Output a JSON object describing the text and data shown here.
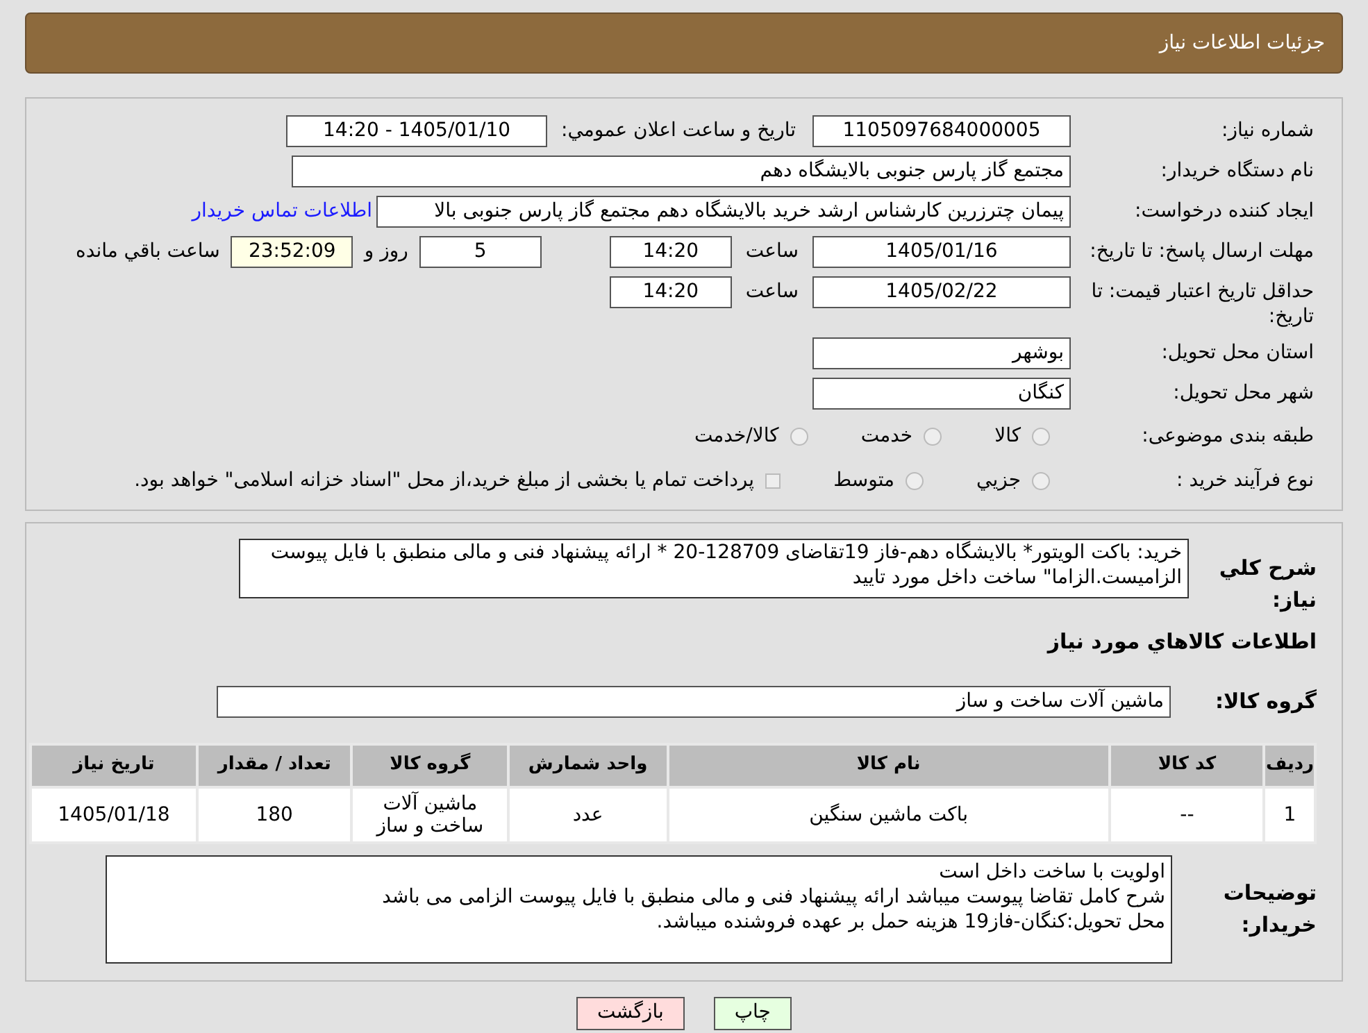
{
  "header": {
    "title": "جزئیات اطلاعات نیاز"
  },
  "details": {
    "need_number": {
      "label": "شماره نیاز:",
      "value": "1105097684000005"
    },
    "announce": {
      "label": "تاریخ و ساعت اعلان عمومي:",
      "value": "1405/01/10 - 14:20"
    },
    "buyer_org": {
      "label": "نام دستگاه خریدار:",
      "value": "مجتمع گاز پارس جنوبی  بالایشگاه دهم"
    },
    "creator": {
      "label": "ایجاد کننده درخواست:",
      "value": "پیمان چترزرین کارشناس ارشد خرید بالایشگاه دهم مجتمع گاز پارس جنوبی  بالا",
      "link": "اطلاعات تماس خریدار"
    },
    "deadline": {
      "label": "مهلت ارسال پاسخ: تا تاریخ:",
      "date": "1405/01/16",
      "time_label": "ساعت",
      "time": "14:20",
      "days": "5",
      "days_label": "روز و",
      "remaining": "23:52:09",
      "remaining_label": "ساعت باقي مانده"
    },
    "validity": {
      "label": "حداقل تاریخ اعتبار قیمت: تا تاریخ:",
      "date": "1405/02/22",
      "time_label": "ساعت",
      "time": "14:20"
    },
    "province": {
      "label": "استان محل تحویل:",
      "value": "بوشهر"
    },
    "city": {
      "label": "شهر محل تحویل:",
      "value": "کنگان"
    },
    "category": {
      "label": "طبقه بندی موضوعی:",
      "options": [
        {
          "label": "کالا",
          "selected": false
        },
        {
          "label": "خدمت",
          "selected": false
        },
        {
          "label": "کالا/خدمت",
          "selected": false
        }
      ]
    },
    "process": {
      "label": "نوع فرآیند خرید :",
      "options": [
        {
          "label": "جزيي",
          "selected": false
        },
        {
          "label": "متوسط",
          "selected": false
        }
      ],
      "payment": {
        "label": "پرداخت تمام یا بخشی از مبلغ خرید،از محل \"اسناد خزانه اسلامی\" خواهد بود.",
        "checked": false
      }
    }
  },
  "summary": {
    "label": "شرح کلي نیاز:",
    "value": "خرید: باکت الویتور* بالایشگاه دهم-فاز 19تقاضای 128709-20 * ارائه پیشنهاد فنی و مالی منطبق با فایل پیوست الزامیست.الزاما\" ساخت داخل مورد تایید"
  },
  "goods_title": "اطلاعات کالاهاي مورد نیاز",
  "goods_group": {
    "label": "گروه کالا:",
    "value": "ماشین آلات ساخت و ساز"
  },
  "table": {
    "columns": [
      "ردیف",
      "کد کالا",
      "نام کالا",
      "واحد شمارش",
      "گروه کالا",
      "تعداد / مقدار",
      "تاریخ نیاز"
    ],
    "rows": [
      [
        "1",
        "--",
        "باکت ماشین سنگین",
        "عدد",
        "ماشین آلات ساخت و ساز",
        "180",
        "1405/01/18"
      ]
    ]
  },
  "notes": {
    "label": "توضیحات خریدار:",
    "lines": [
      "اولویت با ساخت داخل است",
      "شرح کامل تقاضا پیوست میباشد ارائه پیشنهاد فنی و مالی منطبق با فایل پیوست الزامی می باشد",
      "محل تحویل:کنگان-فاز19 هزینه حمل بر عهده فروشنده میباشد."
    ]
  },
  "buttons": [
    {
      "label": "چاپ",
      "kind": "print"
    },
    {
      "label": "بازگشت",
      "kind": "back"
    }
  ]
}
